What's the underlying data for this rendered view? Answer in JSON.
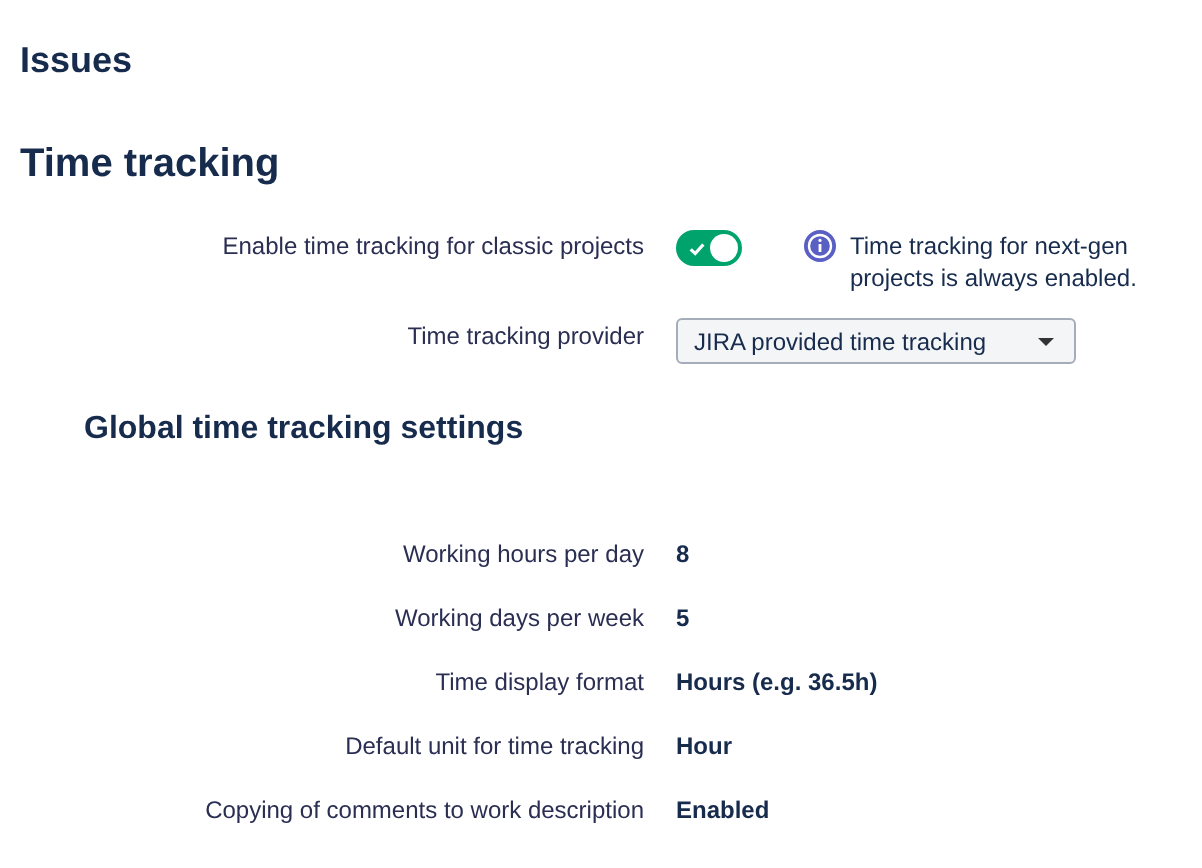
{
  "page_title": "Issues",
  "section_title": "Time tracking",
  "toggle_setting": {
    "label": "Enable time tracking for classic projects",
    "on": true,
    "note": "Time tracking for next-gen projects is always enabled."
  },
  "provider": {
    "label": "Time tracking provider",
    "value": "JIRA provided time tracking"
  },
  "subsection_title": "Global time tracking settings",
  "settings": [
    {
      "label": "Working hours per day",
      "value": "8"
    },
    {
      "label": "Working days per week",
      "value": "5"
    },
    {
      "label": "Time display format",
      "value": "Hours (e.g. 36.5h)"
    },
    {
      "label": "Default unit for time tracking",
      "value": "Hour"
    },
    {
      "label": "Copying of comments to work description",
      "value": "Enabled"
    }
  ]
}
